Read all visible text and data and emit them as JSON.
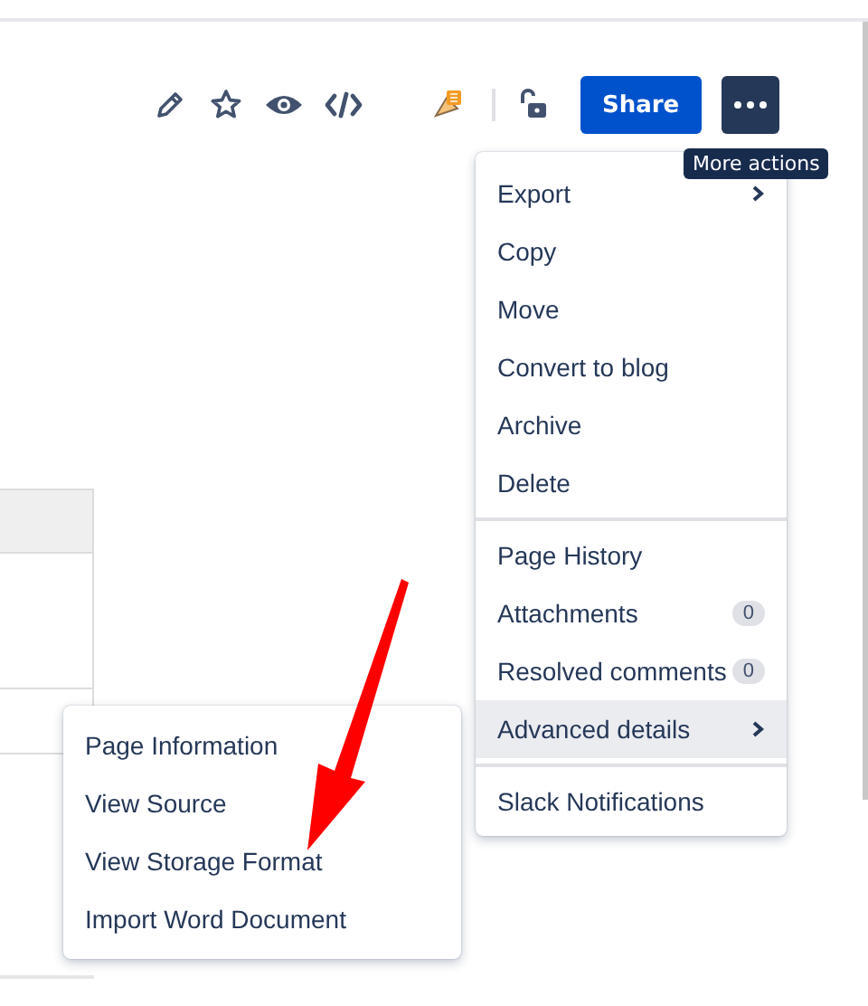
{
  "toolbar": {
    "share_button": "Share",
    "tooltip": "More actions"
  },
  "menu": {
    "sections": [
      {
        "items": [
          {
            "label": "Export",
            "submenu": true,
            "highlighted": false
          },
          {
            "label": "Copy",
            "submenu": false,
            "highlighted": false
          },
          {
            "label": "Move",
            "submenu": false,
            "highlighted": false
          },
          {
            "label": "Convert to blog",
            "submenu": false,
            "highlighted": false
          },
          {
            "label": "Archive",
            "submenu": false,
            "highlighted": false
          },
          {
            "label": "Delete",
            "submenu": false,
            "highlighted": false
          }
        ]
      },
      {
        "items": [
          {
            "label": "Page History",
            "submenu": false,
            "highlighted": false
          },
          {
            "label": "Attachments",
            "badge": "0",
            "submenu": false,
            "highlighted": false
          },
          {
            "label": "Resolved comments",
            "badge": "0",
            "submenu": false,
            "highlighted": false
          },
          {
            "label": "Advanced details",
            "submenu": true,
            "highlighted": true
          }
        ]
      },
      {
        "items": [
          {
            "label": "Slack Notifications",
            "submenu": false,
            "highlighted": false
          }
        ]
      }
    ]
  },
  "submenu": {
    "items": [
      {
        "label": "Page Information"
      },
      {
        "label": "View Source"
      },
      {
        "label": "View Storage Format"
      },
      {
        "label": "Import Word Document"
      }
    ]
  }
}
